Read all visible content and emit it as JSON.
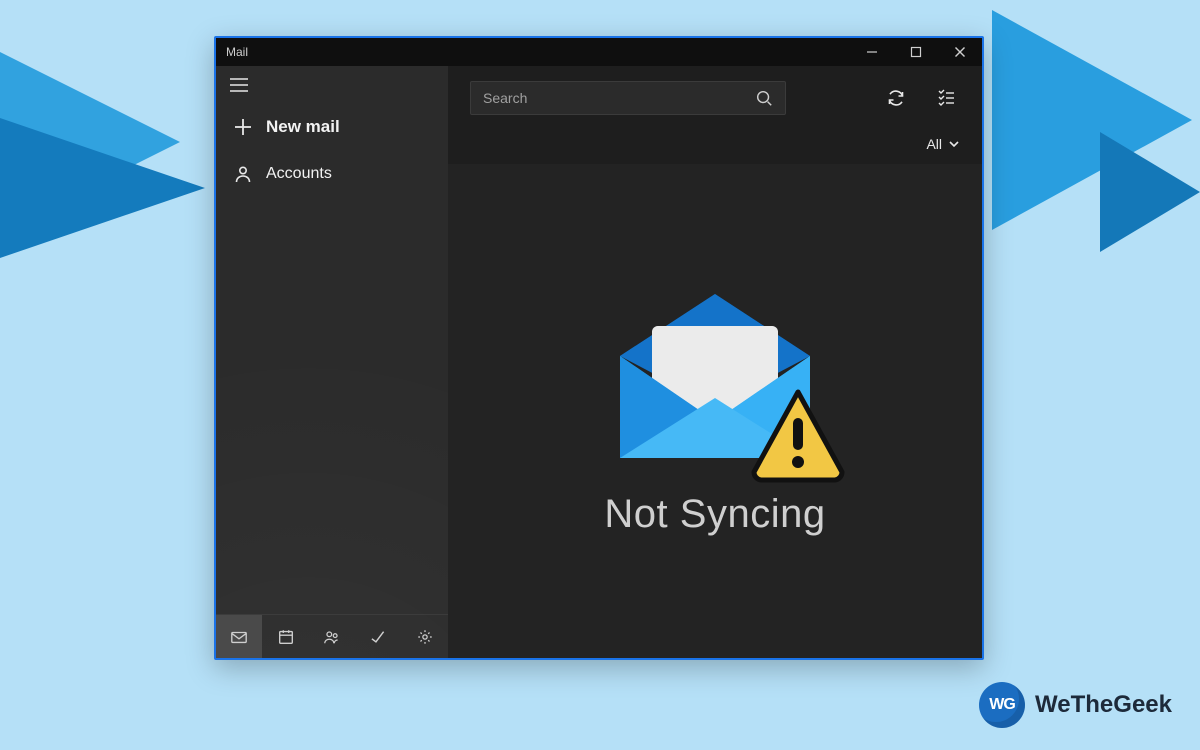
{
  "window": {
    "title": "Mail"
  },
  "search": {
    "placeholder": "Search"
  },
  "sidebar": {
    "new_mail_label": "New mail",
    "accounts_label": "Accounts",
    "bottom": {
      "mail": "Mail",
      "calendar": "Calendar",
      "people": "People",
      "todo": "To Do",
      "settings": "Settings"
    }
  },
  "filter": {
    "label": "All"
  },
  "status": {
    "message": "Not Syncing"
  },
  "brand": {
    "badge": "WG",
    "name": "WeTheGeek"
  },
  "colors": {
    "bg": "#b5e0f7",
    "accent": "#1a73e8",
    "dark1": "#1e1e1e",
    "dark2": "#232323",
    "sidebar": "#2b2b2b",
    "mail_primary": "#1f8fe0",
    "mail_dark": "#0b5aa8",
    "warn": "#f2c744"
  }
}
